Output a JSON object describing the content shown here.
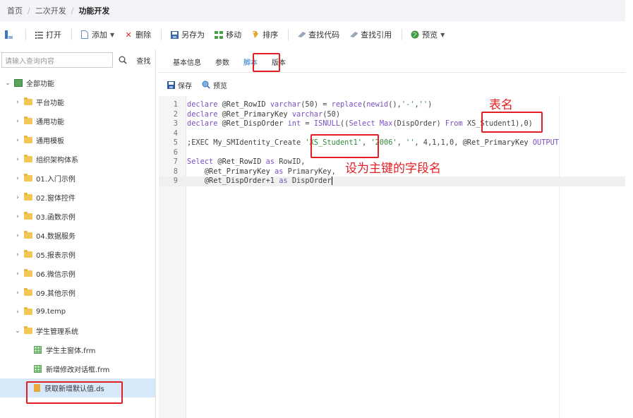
{
  "breadcrumb": {
    "home": "首页",
    "level2": "二次开发",
    "current": "功能开发"
  },
  "toolbar": {
    "open": "打开",
    "add": "添加",
    "delete": "删除",
    "save_as": "另存为",
    "move": "移动",
    "sort": "排序",
    "find_code": "查找代码",
    "find_ref": "查找引用",
    "preview": "预览"
  },
  "search": {
    "placeholder": "请输入查询内容",
    "button": "查找"
  },
  "tree": {
    "root": "全部功能",
    "folders": [
      "平台功能",
      "通用功能",
      "通用模板",
      "组织架构体系",
      "01.入门示例",
      "02.窗体控件",
      "03.函数示例",
      "04.数据服务",
      "05.报表示例",
      "06.微信示例",
      "09.其他示例",
      "99.temp"
    ],
    "student_folder": "学生管理系统",
    "files": [
      "学生主窗体.frm",
      "新增修改对话框.frm",
      "获取新增默认值.ds"
    ]
  },
  "tabs": [
    "基本信息",
    "参数",
    "脚本",
    "版本"
  ],
  "sub_toolbar": {
    "save": "保存",
    "preview": "预览"
  },
  "code_lines": [
    {
      "n": "1",
      "t": "declare @Ret_RowID varchar(50) = replace(newid(),'-','')"
    },
    {
      "n": "2",
      "t": "declare @Ret_PrimaryKey varchar(50)"
    },
    {
      "n": "3",
      "t": "declare @Ret_DispOrder int = ISNULL((Select Max(DispOrder) From XS_Student1),0)"
    },
    {
      "n": "4",
      "t": ""
    },
    {
      "n": "5",
      "t": ";EXEC My_SMIdentity_Create 'XS_Student1', '2006', '', 4,1,1,0, @Ret_PrimaryKey OUTPUT"
    },
    {
      "n": "6",
      "t": ""
    },
    {
      "n": "7",
      "t": "Select @Ret_RowID as RowID,"
    },
    {
      "n": "8",
      "t": "    @Ret_PrimaryKey as PrimaryKey,"
    },
    {
      "n": "9",
      "t": "    @Ret_DispOrder+1 as DispOrder"
    }
  ],
  "annotations": {
    "table_name": "表名",
    "primary_key_field": "设为主键的字段名"
  },
  "colors": {
    "highlight": "#e31e24",
    "accent": "#1a73c6",
    "folder": "#f3c756"
  }
}
